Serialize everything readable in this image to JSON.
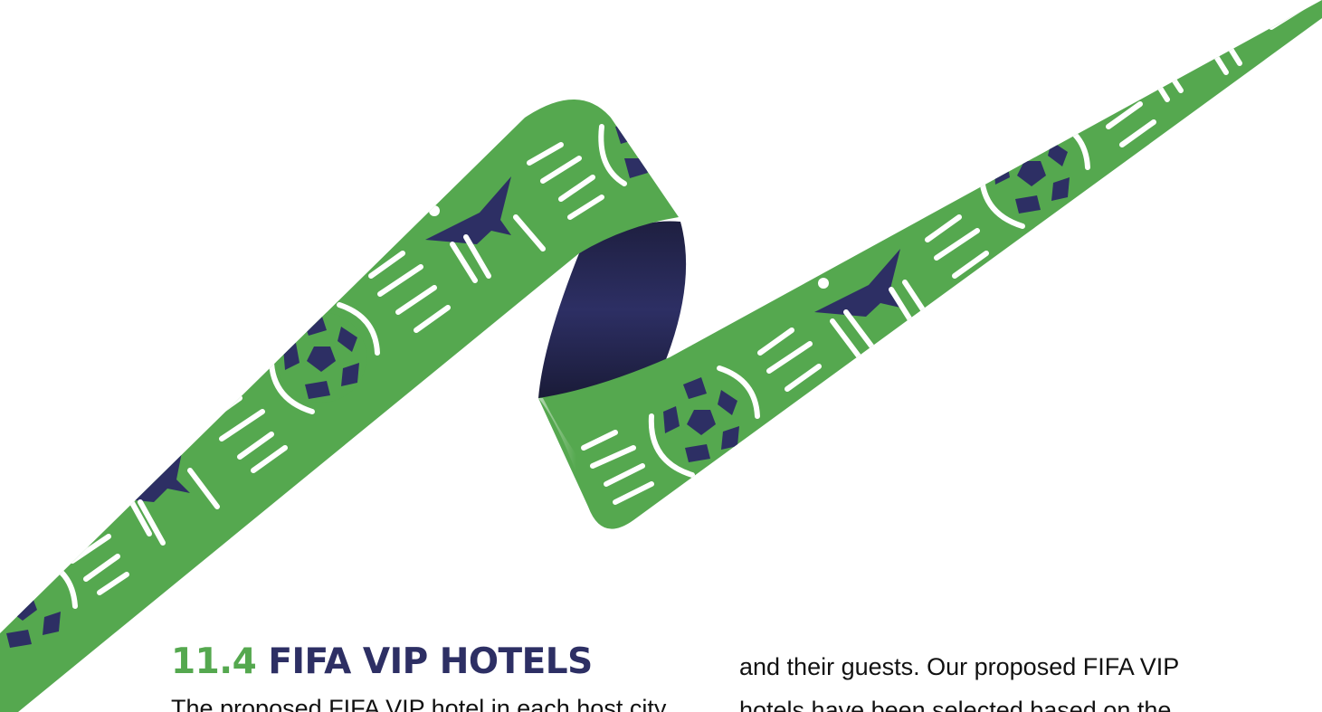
{
  "section": {
    "number": "11.4",
    "title": "FIFA VIP HOTELS"
  },
  "body": {
    "left_column": [
      "The proposed FIFA VIP hotel in each host city"
    ],
    "right_column": [
      "and their guests. Our proposed FIFA VIP",
      "hotels have been selected based on the"
    ]
  },
  "colors": {
    "ribbon_green": "#55a84f",
    "navy": "#2d2f64",
    "white": "#ffffff"
  },
  "icons": [
    "football-icon",
    "bird-icon",
    "speed-lines-icon"
  ]
}
